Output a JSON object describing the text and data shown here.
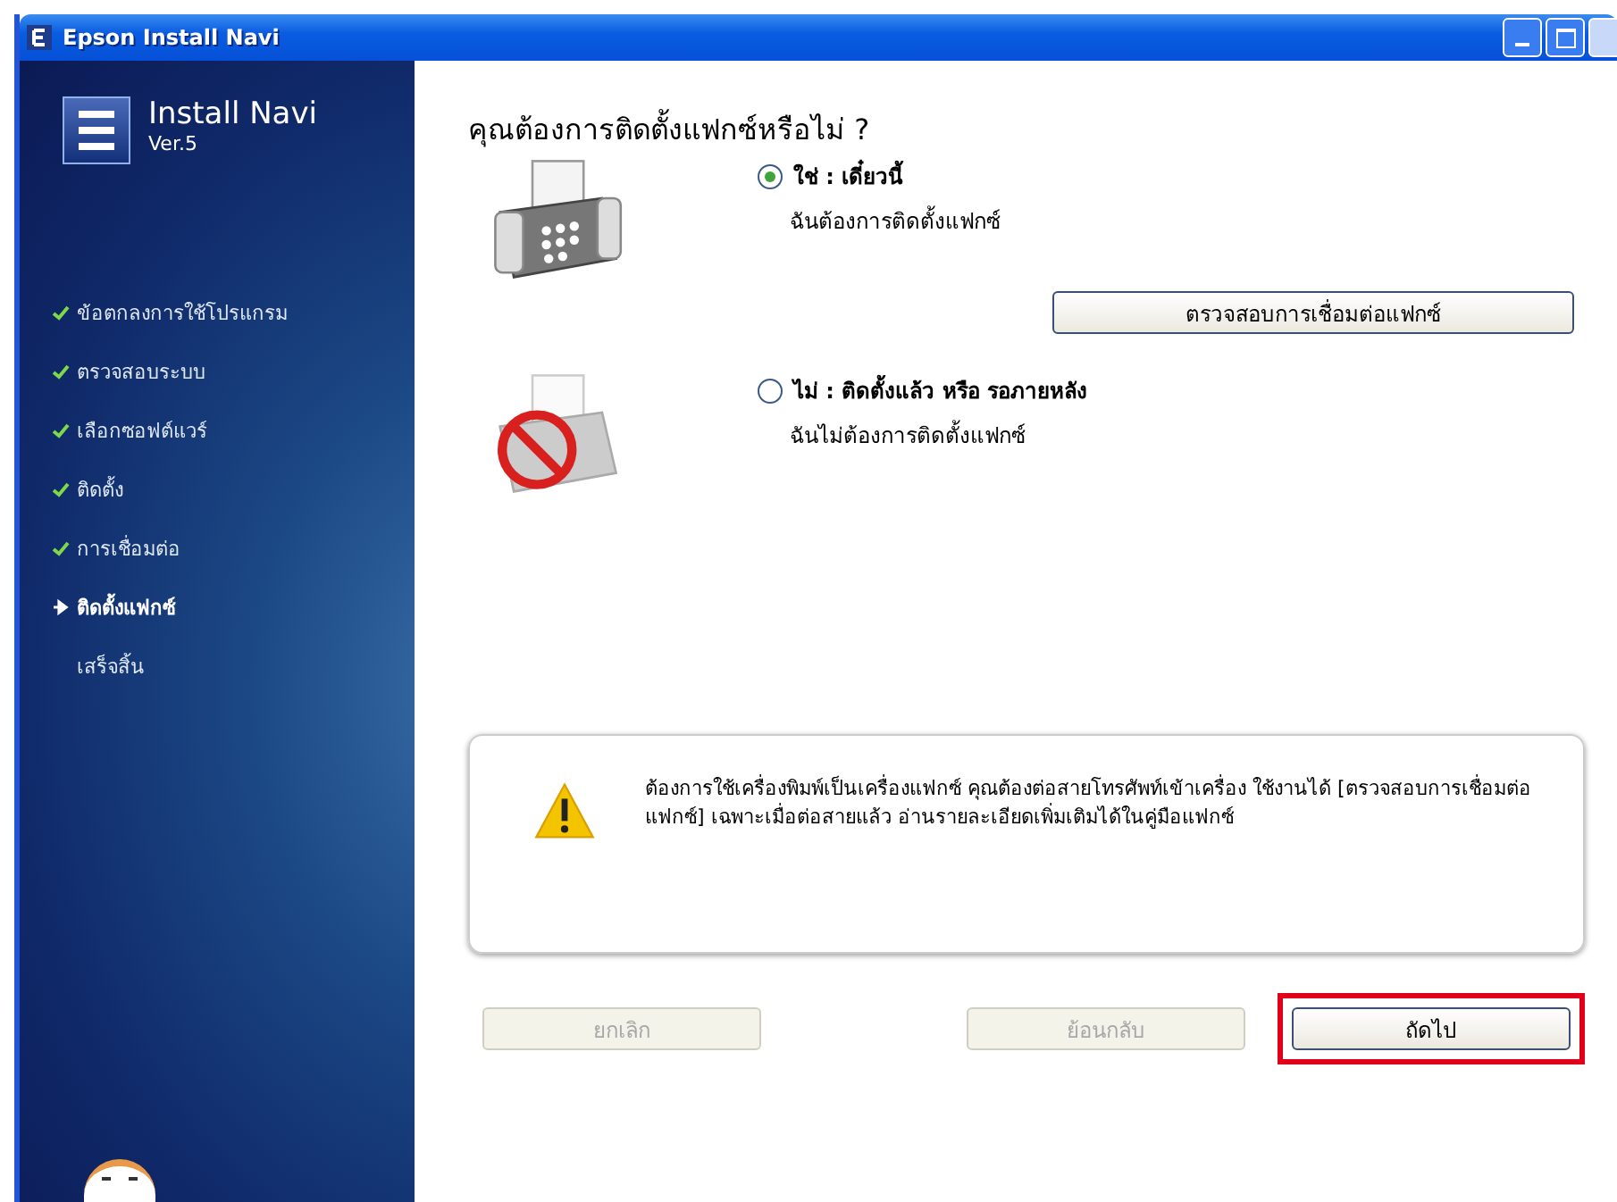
{
  "window": {
    "title": "Epson Install Navi"
  },
  "sidebar": {
    "logo_title": "Install Navi",
    "logo_version": "Ver.5",
    "steps": [
      {
        "label": "ข้อตกลงการใช้โปรแกรม",
        "kind": "done"
      },
      {
        "label": "ตรวจสอบระบบ",
        "kind": "done"
      },
      {
        "label": "เลือกซอฟต์แวร์",
        "kind": "done"
      },
      {
        "label": "ติดตั้ง",
        "kind": "done"
      },
      {
        "label": "การเชื่อมต่อ",
        "kind": "done"
      },
      {
        "label": "ติดตั้งแฟกซ์",
        "kind": "current"
      },
      {
        "label": "เสร็จสิ้น",
        "kind": "pending"
      }
    ]
  },
  "heading": "คุณต้องการติดตั้งแฟกซ์หรือไม่ ?",
  "options": [
    {
      "kind": "yes",
      "label": "ใช่ : เดี๋ยวนี้",
      "description": "ฉันต้องการติดตั้งแฟกซ์",
      "selected": true
    },
    {
      "kind": "no",
      "label": "ไม่ : ติดตั้งแล้ว หรือ รอภายหลัง",
      "description": "ฉันไม่ต้องการติดตั้งแฟกซ์",
      "selected": false
    }
  ],
  "check_button": "ตรวจสอบการเชื่อมต่อแฟกซ์",
  "notice": "ต้องการใช้เครื่องพิมพ์เป็นเครื่องแฟกซ์ คุณต้องต่อสายโทรศัพท์เข้าเครื่อง ใช้งานได้ [ตรวจสอบการเชื่อมต่อแฟกซ์] เฉพาะเมื่อต่อสายแล้ว อ่านรายละเอียดเพิ่มเติมได้ในคู่มือแฟกซ์",
  "buttons": [
    {
      "kind": "cancel",
      "label": "ยกเลิก",
      "disabled": true,
      "highlighted": false
    },
    {
      "kind": "back",
      "label": "ย้อนกลับ",
      "disabled": true,
      "highlighted": false
    },
    {
      "kind": "next",
      "label": "ถัดไป",
      "disabled": false,
      "highlighted": true
    }
  ]
}
